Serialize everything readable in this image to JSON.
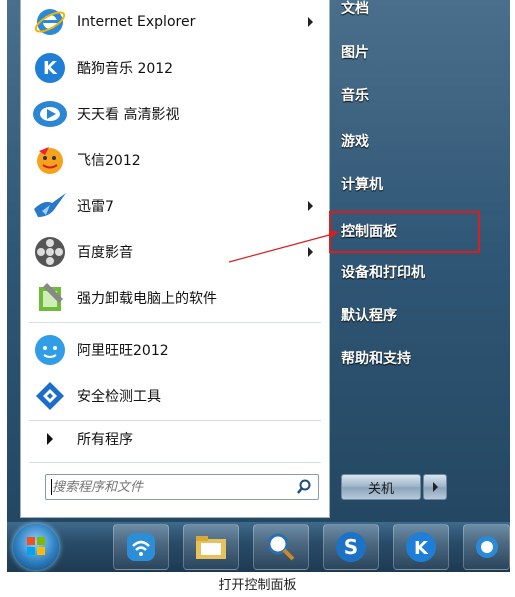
{
  "start_menu": {
    "programs": [
      {
        "label": "Internet Explorer",
        "icon": "internet-explorer-icon",
        "submenu": true
      },
      {
        "label": "酷狗音乐 2012",
        "icon": "kugou-music-icon",
        "submenu": false
      },
      {
        "label": "天天看 高清影视",
        "icon": "tiantiankan-icon",
        "submenu": false
      },
      {
        "label": "飞信2012",
        "icon": "fetion-icon",
        "submenu": false
      },
      {
        "label": "迅雷7",
        "icon": "thunder-icon",
        "submenu": true
      },
      {
        "label": "百度影音",
        "icon": "baidu-player-icon",
        "submenu": true
      },
      {
        "label": "强力卸载电脑上的软件",
        "icon": "uninstaller-icon",
        "submenu": false
      },
      {
        "label": "阿里旺旺2012",
        "icon": "aliwangwang-icon",
        "submenu": false
      },
      {
        "label": "安全检测工具",
        "icon": "security-tool-icon",
        "submenu": false
      }
    ],
    "all_programs": "所有程序",
    "search": {
      "placeholder": "搜索程序和文件"
    },
    "right_items": [
      {
        "label": "文档"
      },
      {
        "label": "图片"
      },
      {
        "label": "音乐"
      },
      {
        "label": "游戏"
      },
      {
        "label": "计算机"
      },
      {
        "label": "控制面板"
      },
      {
        "label": "设备和打印机"
      },
      {
        "label": "默认程序"
      },
      {
        "label": "帮助和支持"
      }
    ],
    "highlighted_item": "控制面板",
    "highlight_color": "#d81e1e",
    "shutdown_label": "关机"
  },
  "taskbar": {
    "items": [
      "start-orb-icon",
      "wifi-app-icon",
      "folder-icon",
      "search-app-icon",
      "sogou-icon",
      "kugou-icon"
    ]
  },
  "caption": "打开控制面板"
}
